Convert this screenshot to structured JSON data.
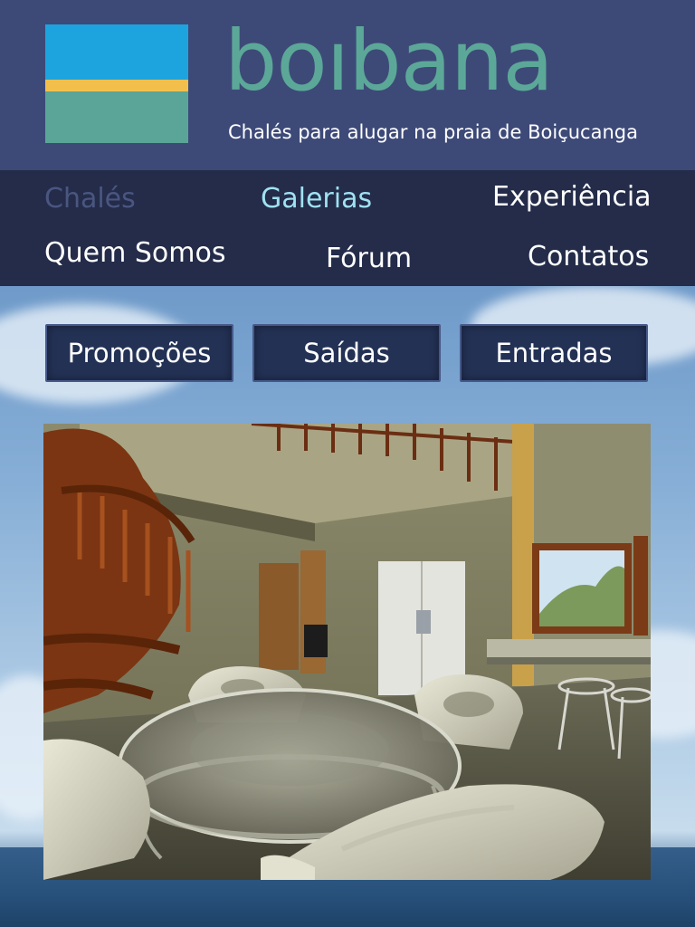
{
  "brand": {
    "name": "boıbana",
    "tagline": "Chalés para alugar na praia de Boiçucanga"
  },
  "nav": {
    "items": [
      {
        "label": "Chalés",
        "state": "inactive"
      },
      {
        "label": "Galerias",
        "state": "active"
      },
      {
        "label": "Experiência",
        "state": "normal"
      },
      {
        "label": "Quem Somos",
        "state": "normal"
      },
      {
        "label": "Fórum",
        "state": "normal"
      },
      {
        "label": "Contatos",
        "state": "normal"
      }
    ]
  },
  "buttons": [
    {
      "label": "Promoções"
    },
    {
      "label": "Saídas"
    },
    {
      "label": "Entradas"
    }
  ],
  "colors": {
    "header": "#3d4a78",
    "nav": "#242c4a",
    "brand": "#5ca898",
    "active": "#9fe2f2",
    "inactive": "#4a5680",
    "logo_sky": "#1da4de",
    "logo_sand": "#f2bf4d",
    "logo_sea": "#5aa597"
  }
}
